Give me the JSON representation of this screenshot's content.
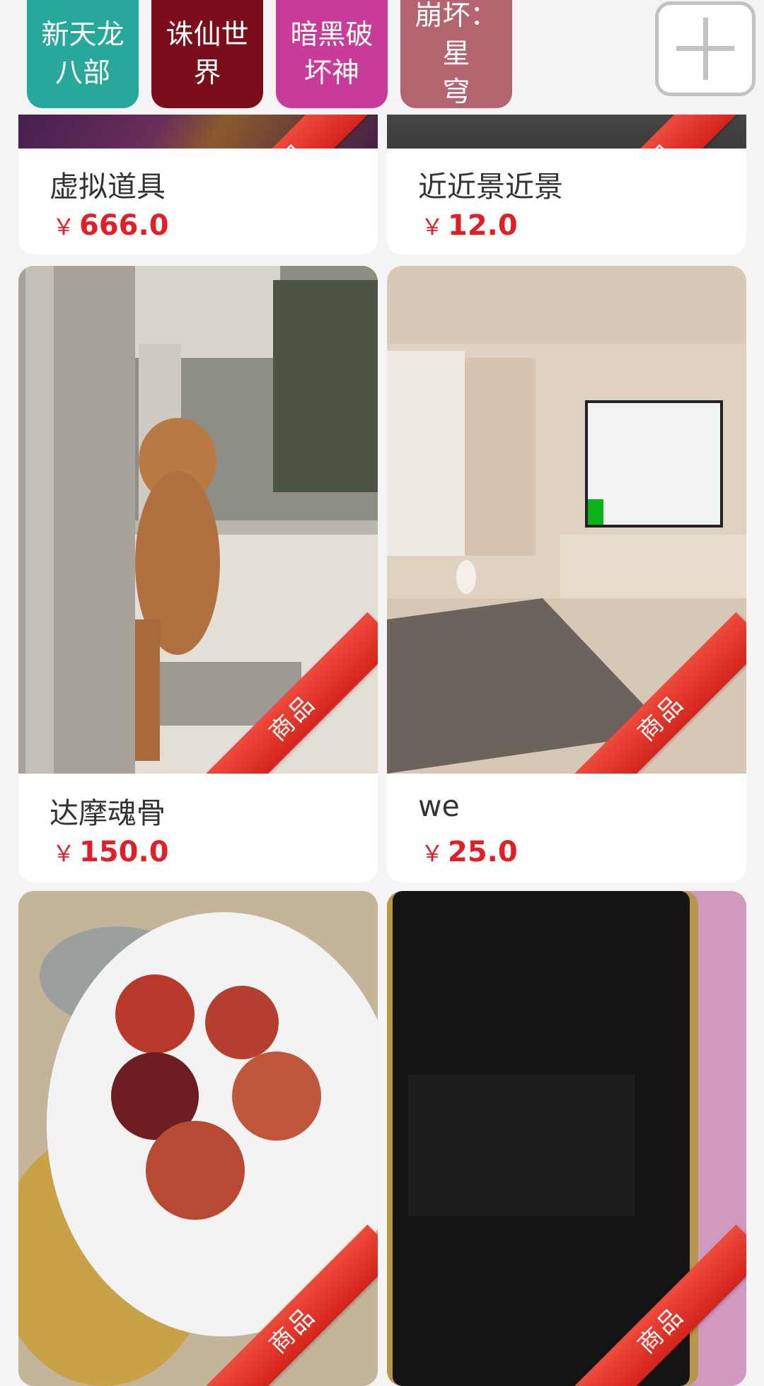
{
  "tags": [
    {
      "label_line1": "新天龙",
      "label_line2": "八部",
      "color": "#27a89a"
    },
    {
      "label_line1": "诛仙世",
      "label_line2": "界",
      "color": "#7a0f1b"
    },
    {
      "label_line1": "暗黑破",
      "label_line2": "坏神",
      "color": "#c83b99"
    },
    {
      "label_line1": "崩坏：星",
      "label_line2": "穹",
      "color": "#b3646e"
    }
  ],
  "add_button_icon": "plus-icon",
  "ribbon_label": "商品",
  "currency": "￥",
  "products": [
    {
      "title": "虚拟道具",
      "price": "666.0"
    },
    {
      "title": "近近景近景",
      "price": "12.0"
    },
    {
      "title": "达摩魂骨",
      "price": "150.0"
    },
    {
      "title": "we",
      "price": "25.0"
    },
    {
      "title": "",
      "price": ""
    },
    {
      "title": "",
      "price": ""
    }
  ]
}
